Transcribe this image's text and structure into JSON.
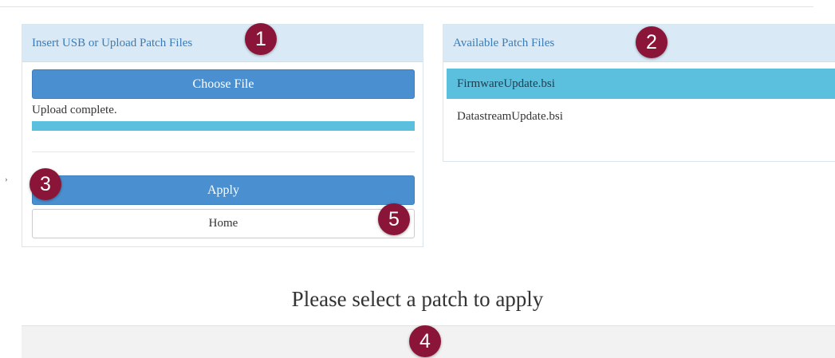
{
  "upload_panel": {
    "title": "Insert USB or Upload Patch Files",
    "choose_file_label": "Choose File",
    "status": "Upload complete.",
    "progress": 1.0,
    "apply_label": "Apply",
    "home_label": "Home"
  },
  "files_panel": {
    "title": "Available Patch Files",
    "files": [
      {
        "name": "FirmwareUpdate.bsi",
        "selected": true
      },
      {
        "name": "DatastreamUpdate.bsi",
        "selected": false
      }
    ]
  },
  "prompt": "Please select a patch to apply",
  "edge_marker": "›",
  "callouts": [
    "1",
    "2",
    "3",
    "4",
    "5"
  ],
  "colors": {
    "primary_button": "#4a8fcf",
    "selection": "#5bc0de",
    "panel_header": "#d9eaf6",
    "callout": "#8a1538"
  }
}
